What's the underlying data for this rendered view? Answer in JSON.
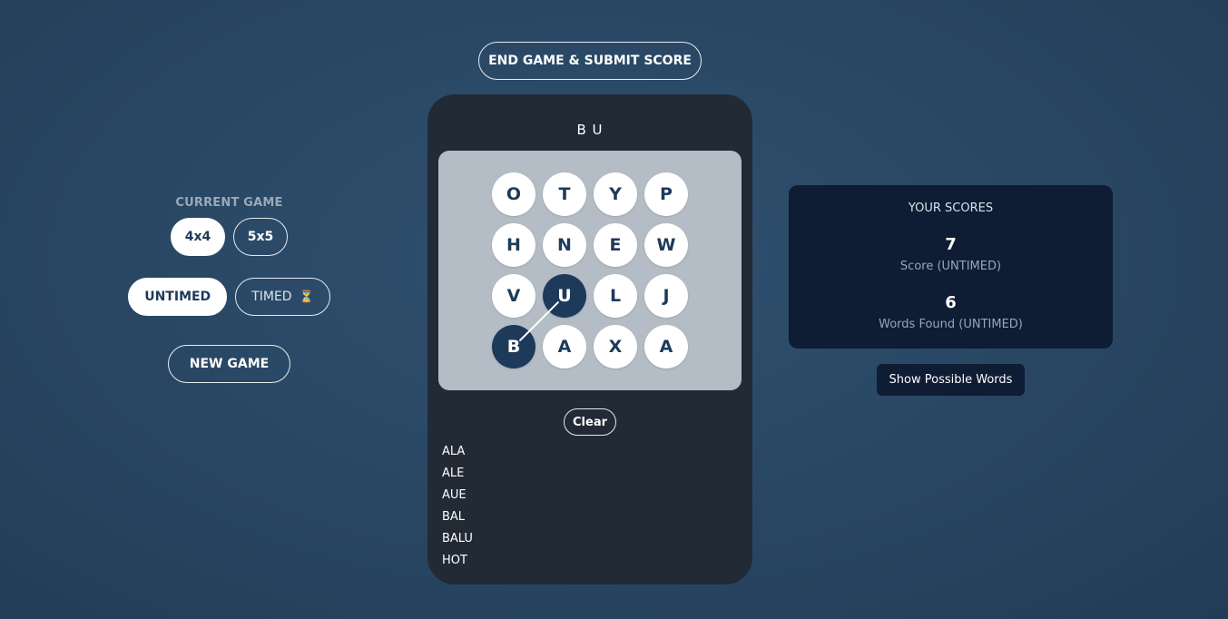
{
  "end_game_label": "END GAME & SUBMIT SCORE",
  "left_panel": {
    "current_game_label": "CURRENT GAME",
    "size_options": [
      {
        "label": "4x4",
        "selected": true
      },
      {
        "label": "5x5",
        "selected": false
      }
    ],
    "mode_options": [
      {
        "label": "UNTIMED",
        "selected": true
      },
      {
        "label": "TIMED",
        "icon": "⏳",
        "icon_name": "hourglass-icon",
        "selected": false
      }
    ],
    "new_game_label": "NEW GAME"
  },
  "game": {
    "current_word": "B U",
    "grid": [
      [
        "O",
        "T",
        "Y",
        "P"
      ],
      [
        "H",
        "N",
        "E",
        "W"
      ],
      [
        "V",
        "U",
        "L",
        "J"
      ],
      [
        "B",
        "A",
        "X",
        "A"
      ]
    ],
    "selected_path": [
      [
        3,
        0
      ],
      [
        2,
        1
      ]
    ],
    "clear_label": "Clear",
    "found_words": [
      "ALA",
      "ALE",
      "AUE",
      "BAL",
      "BALU",
      "HOT"
    ]
  },
  "scores": {
    "title": "YOUR SCORES",
    "score_value": "7",
    "score_label": "Score (UNTIMED)",
    "words_value": "6",
    "words_label": "Words Found (UNTIMED)"
  },
  "show_words_label": "Show Possible Words",
  "colors": {
    "tile_selected": "#1e3a5a",
    "tile_default": "#ffffff",
    "panel_dark": "#212a35",
    "scores_bg": "#0e1c34",
    "board_bg": "#b4bcc5"
  }
}
